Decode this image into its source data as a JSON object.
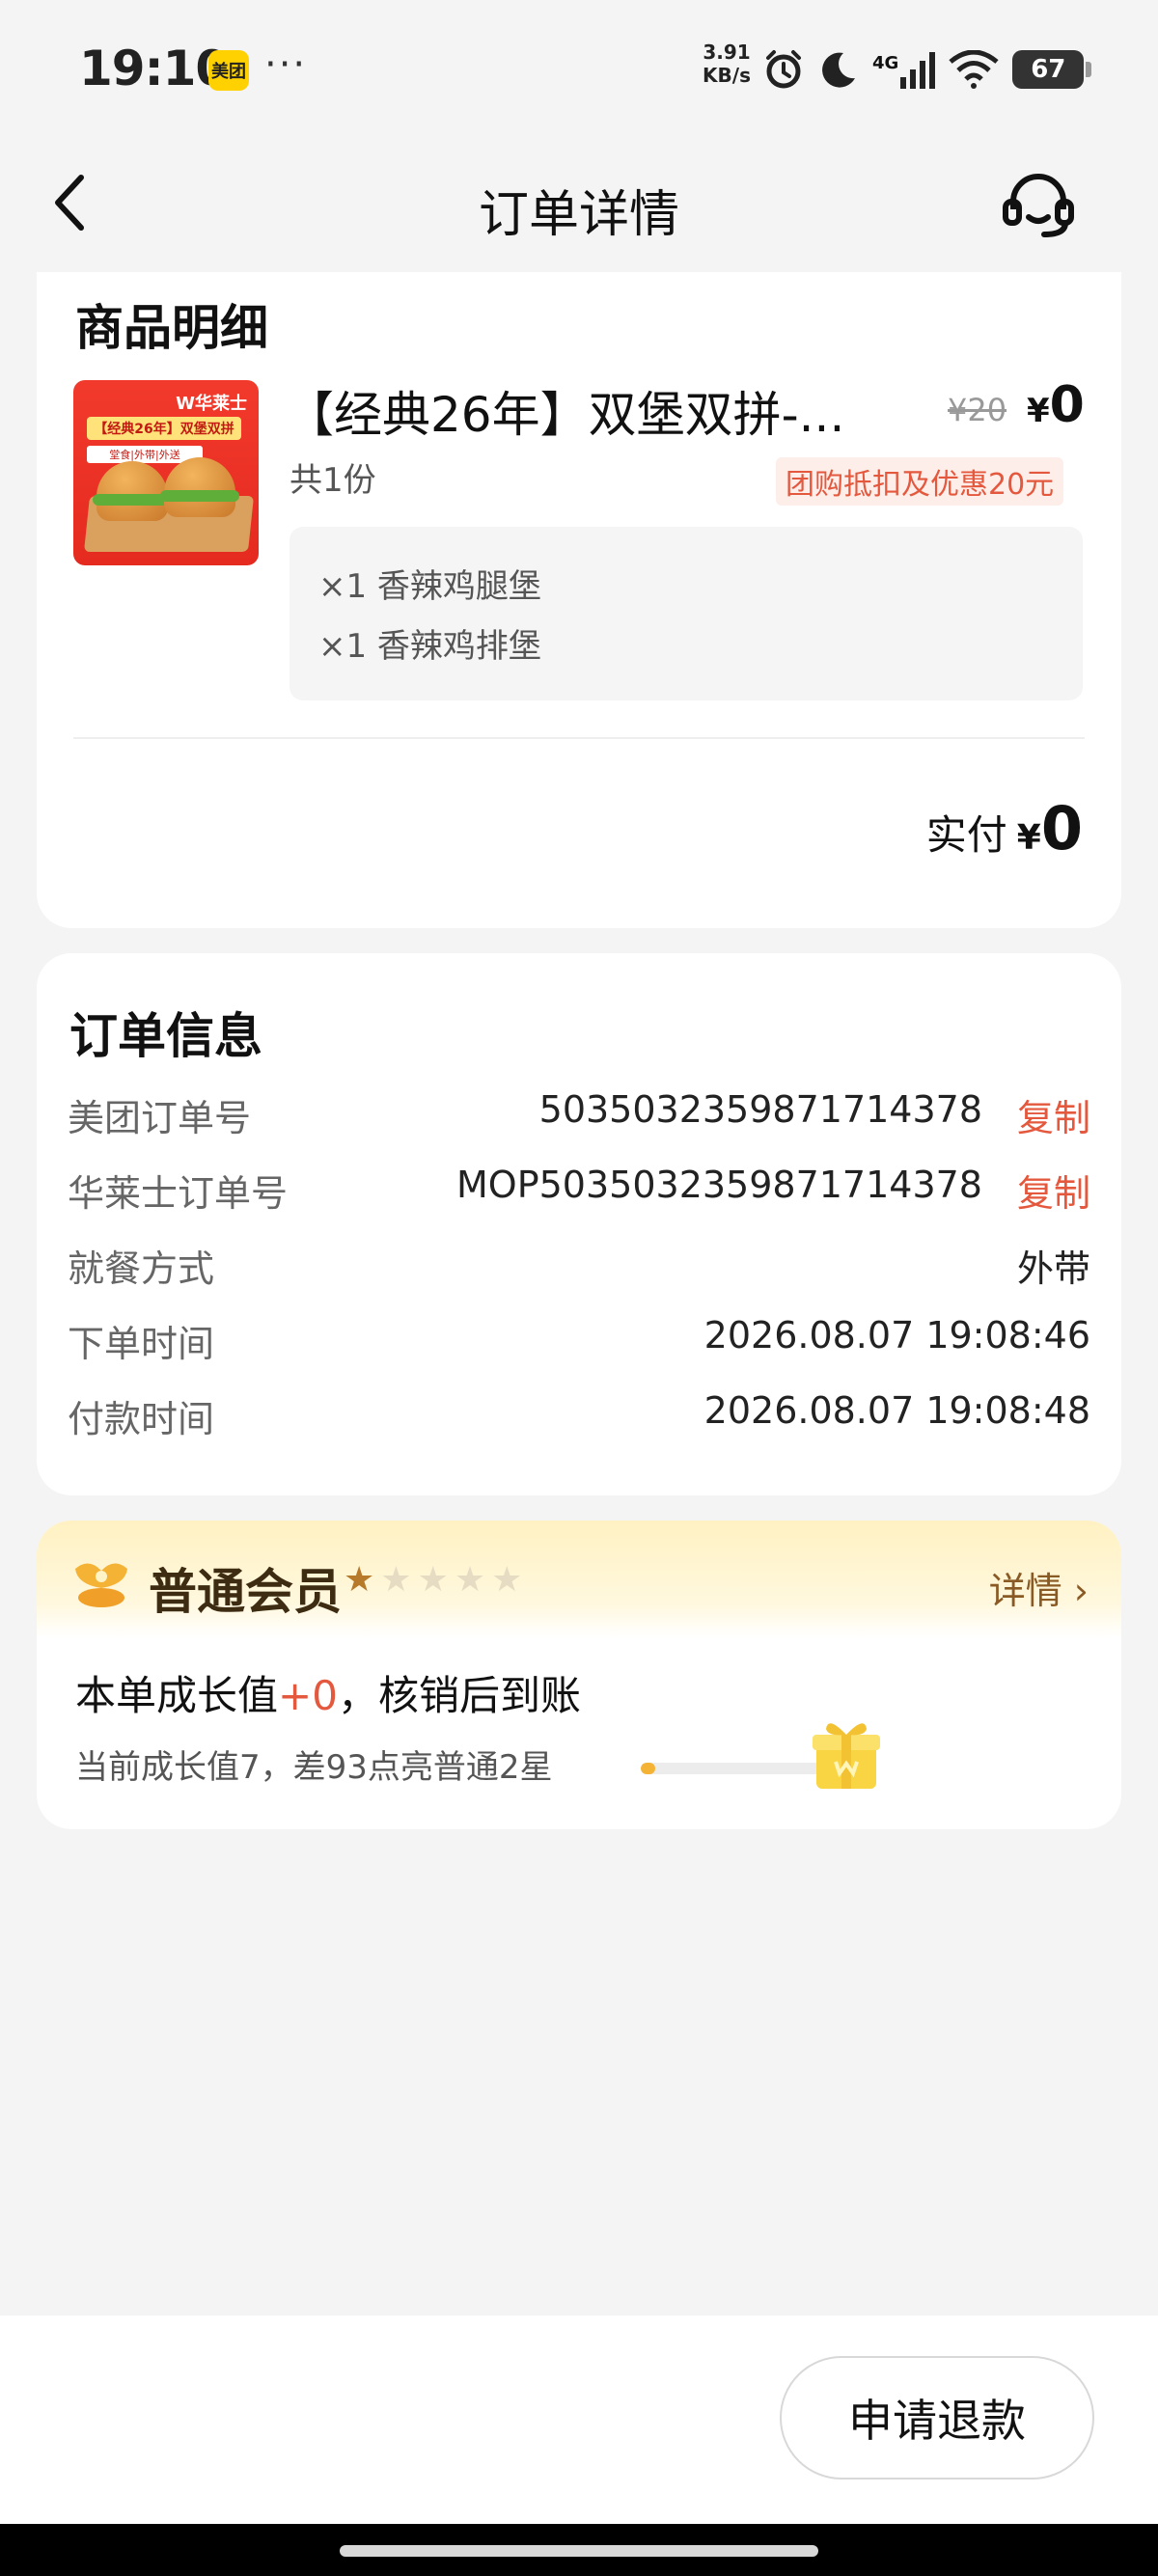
{
  "status_bar": {
    "time": "19:10",
    "app_badge": "美团",
    "more": "···",
    "net_speed_value": "3.91",
    "net_speed_unit": "KB/s",
    "network": "4G",
    "battery": "67",
    "icons": [
      "alarm-icon",
      "moon-icon",
      "signal-icon",
      "wifi-icon",
      "battery-icon"
    ]
  },
  "nav": {
    "title": "订单详情",
    "back_icon": "chevron-left-icon",
    "service_icon": "headset-icon"
  },
  "goods": {
    "section_title": "商品明细",
    "thumb_logo": "W华莱士",
    "thumb_banner": "【经典26年】双堡双拼",
    "thumb_tags": "堂食|外带|外送",
    "name": "【经典26年】双堡双拼-...",
    "original_price": "¥20",
    "price_symbol": "¥",
    "price": "0",
    "quantity": "共1份",
    "discount": "团购抵扣及优惠20元",
    "sub_items": [
      "×1 香辣鸡腿堡",
      "×1 香辣鸡排堡"
    ],
    "paid_label": "实付",
    "paid_symbol": "¥",
    "paid_amount": "0"
  },
  "order_info": {
    "title": "订单信息",
    "copy_label": "复制",
    "rows": [
      {
        "label": "美团订单号",
        "value": "5035032359871714378"
      },
      {
        "label": "华莱士订单号",
        "value": "MOP5035032359871714378"
      },
      {
        "label": "就餐方式",
        "value": "外带"
      },
      {
        "label": "下单时间",
        "value": "2026.08.07 19:08:46"
      },
      {
        "label": "付款时间",
        "value": "2026.08.07 19:08:48"
      }
    ]
  },
  "member": {
    "title": "普通会员",
    "stars_filled": 1,
    "stars_total": 5,
    "detail_link": "详情 ›",
    "growth_prefix": "本单成长值",
    "growth_plus": "+0",
    "growth_suffix": "，核销后到账",
    "growth_status": "当前成长值7，差93点亮普通2星",
    "progress": 0.07,
    "accent_color": "#f5b336"
  },
  "actions": {
    "refund": "申请退款"
  },
  "colors": {
    "accent_red": "#e4583e",
    "member_brown": "#8a5a24",
    "background": "#f4f4f4"
  }
}
